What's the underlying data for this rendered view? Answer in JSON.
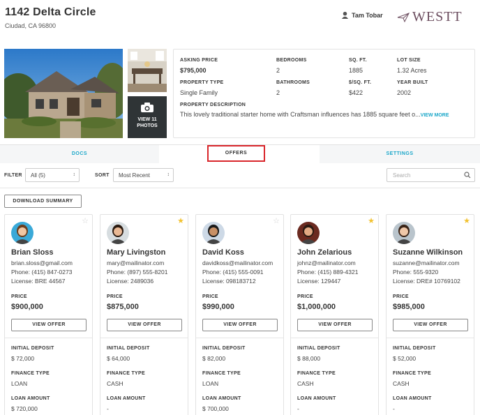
{
  "property": {
    "address": "1142 Delta Circle",
    "city": "Ciudad, CA 96800"
  },
  "agent": {
    "name": "Tam Tobar",
    "icon": "user-icon"
  },
  "brand": {
    "name": "WESTT",
    "color": "#6b4c5e"
  },
  "photos": {
    "view_label_1": "VIEW 11",
    "view_label_2": "PHOTOS"
  },
  "details": {
    "asking_price_label": "ASKING PRICE",
    "asking_price": "$795,000",
    "bedrooms_label": "BEDROOMS",
    "bedrooms": "2",
    "sqft_label": "SQ. FT.",
    "sqft": "1885",
    "lot_label": "LOT SIZE",
    "lot": "1.32 Acres",
    "type_label": "PROPERTY TYPE",
    "type": "Single Family",
    "bathrooms_label": "BATHROOMS",
    "bathrooms": "2",
    "psf_label": "$/SQ. FT.",
    "psf": "$422",
    "year_label": "YEAR BUILT",
    "year": "2002",
    "desc_label": "PROPERTY DESCRIPTION",
    "desc": "This lovely traditional starter home with Craftsman influences has 1885 square feet o...",
    "view_more": "VIEW MORE"
  },
  "tabs": {
    "docs": "DOCS",
    "offers": "OFFERS",
    "settings": "SETTINGS"
  },
  "filters": {
    "filter_label": "FILTER",
    "filter_value": "All (5)",
    "sort_label": "SORT",
    "sort_value": "Most Recent",
    "search_placeholder": "Search"
  },
  "download_label": "DOWNLOAD SUMMARY",
  "labels": {
    "price": "PRICE",
    "view_offer": "VIEW OFFER",
    "initial_deposit": "INITIAL DEPOSIT",
    "finance_type": "FINANCE TYPE",
    "loan_amount": "LOAN AMOUNT"
  },
  "colors": {
    "accent": "#1ba7c9",
    "star": "#f2c230",
    "highlight": "#d9262b"
  },
  "offers": [
    {
      "name": "Brian Sloss",
      "email": "brian.sloss@gmail.com",
      "phone": "Phone: (415) 847-0273",
      "license": "License: BRE 44567",
      "price": "$900,000",
      "deposit": "$ 72,000",
      "finance": "LOAN",
      "loan": "$ 720,000",
      "starred": false
    },
    {
      "name": "Mary Livingston",
      "email": "mary@mailinator.com",
      "phone": "Phone: (897) 555-8201",
      "license": "License: 2489036",
      "price": "$875,000",
      "deposit": "$ 64,000",
      "finance": "CASH",
      "loan": "-",
      "starred": true
    },
    {
      "name": "David Koss",
      "email": "davidkoss@mailinator.com",
      "phone": "Phone: (415) 555-0091",
      "license": "License: 098183712",
      "price": "$990,000",
      "deposit": "$ 82,000",
      "finance": "LOAN",
      "loan": "$ 700,000",
      "starred": false
    },
    {
      "name": "John Zelarious",
      "email": "johnz@mailinator.com",
      "phone": "Phone: (415) 889-4321",
      "license": "License: 129447",
      "price": "$1,000,000",
      "deposit": "$ 88,000",
      "finance": "CASH",
      "loan": "-",
      "starred": true
    },
    {
      "name": "Suzanne Wilkinson",
      "email": "suzanne@mailinator.com",
      "phone": "Phone: 555-9320",
      "license": "License: DRE# 10769102",
      "price": "$985,000",
      "deposit": "$ 52,000",
      "finance": "CASH",
      "loan": "-",
      "starred": true
    }
  ]
}
